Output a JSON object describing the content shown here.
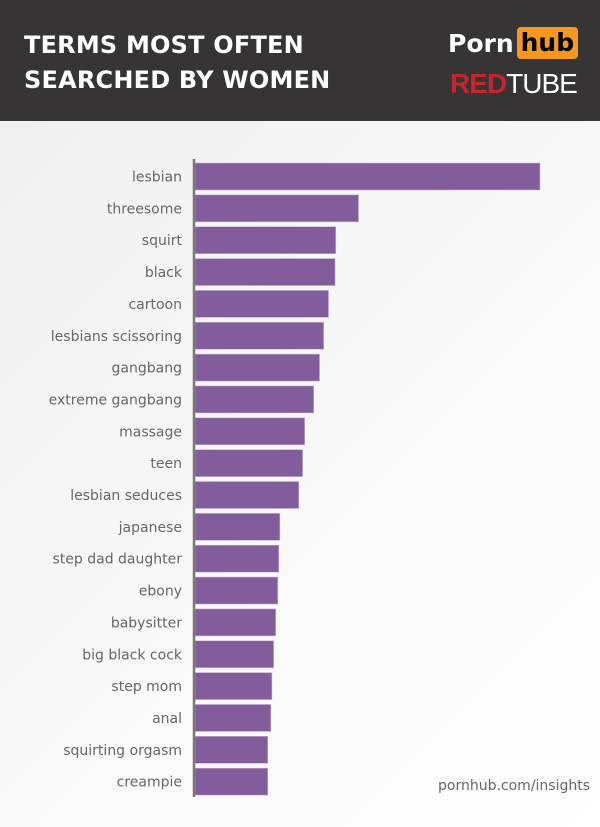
{
  "header": {
    "title_line1": "TERMS MOST OFTEN",
    "title_line2": "SEARCHED BY WOMEN",
    "logo_pornhub_part1": "Porn",
    "logo_pornhub_part2": "hub",
    "logo_redtube_part1": "RED",
    "logo_redtube_part2": "TUBE"
  },
  "footer": {
    "source": "pornhub.com/insights"
  },
  "colors": {
    "bar": "#835c9c",
    "axis": "#777777",
    "label": "#666666",
    "header_bg": "#363435",
    "hub_orange": "#f7971d",
    "redtube_red": "#c4262e"
  },
  "chart_data": {
    "type": "bar",
    "orientation": "horizontal",
    "title": "Terms Most Often Searched By Women",
    "xlabel": "",
    "ylabel": "",
    "value_units": "relative index (lesbian = 100), estimated from bar lengths; no axis shown",
    "xlim": [
      0,
      100
    ],
    "grid": false,
    "legend": "none",
    "categories": [
      "lesbian",
      "threesome",
      "squirt",
      "black",
      "cartoon",
      "lesbians scissoring",
      "gangbang",
      "extreme gangbang",
      "massage",
      "teen",
      "lesbian seduces",
      "japanese",
      "step dad daughter",
      "ebony",
      "babysitter",
      "big black cock",
      "step mom",
      "anal",
      "squirting orgasm",
      "creampie"
    ],
    "values": [
      100,
      47.4,
      40.8,
      40.6,
      38.7,
      37.3,
      36.1,
      34.4,
      31.8,
      31.2,
      30.1,
      24.6,
      24.3,
      24.0,
      23.4,
      22.8,
      22.3,
      22.0,
      21.1,
      21.1
    ]
  }
}
